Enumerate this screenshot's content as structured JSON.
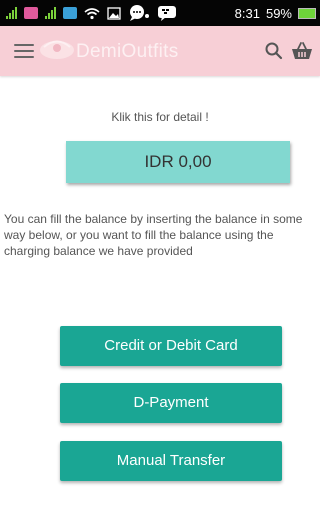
{
  "status_bar": {
    "time": "8:31",
    "battery": "59%"
  },
  "app_bar": {
    "title": "DemiOutfits"
  },
  "main": {
    "detail_hint": "Klik this for detail !",
    "balance": "IDR 0,00",
    "info": "You can fill the balance by inserting the balance in some way below, or you want to fill the balance using the charging balance we have provided",
    "buttons": {
      "card": "Credit or Debit Card",
      "dpayment": "D-Payment",
      "manual": "Manual Transfer"
    }
  },
  "colors": {
    "app_bar": "#f7cfd6",
    "balance_box": "#82d8d0",
    "button": "#1aa694",
    "status_bar": "#050505"
  }
}
